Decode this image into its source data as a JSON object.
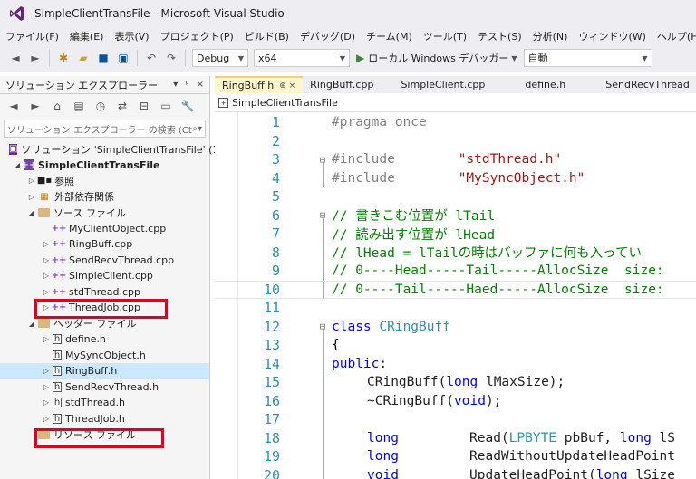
{
  "window": {
    "title": "SimpleClientTransFile - Microsoft Visual Studio"
  },
  "menu": [
    "ファイル(F)",
    "編集(E)",
    "表示(V)",
    "プロジェクト(P)",
    "ビルド(B)",
    "デバッグ(D)",
    "チーム(M)",
    "ツール(T)",
    "テスト(S)",
    "分析(N)",
    "ウィンドウ(W)",
    "ヘルプ(H)"
  ],
  "toolbar": {
    "config": "Debug",
    "platform": "x64",
    "run_label": "ローカル Windows デバッガー",
    "run_mode": "自動"
  },
  "solution_explorer": {
    "title": "ソリューション エクスプローラー",
    "search_placeholder": "ソリューション エクスプローラー の検索 (Ct",
    "items": [
      {
        "label": "ソリューション 'SimpleClientTransFile' (1",
        "icon": "solution-icon"
      },
      {
        "label": "SimpleClientTransFile",
        "icon": "project-icon"
      },
      {
        "label": "参照",
        "icon": "references-icon"
      },
      {
        "label": "外部依存関係",
        "icon": "external-deps-icon"
      },
      {
        "label": "ソース ファイル",
        "icon": "folder-icon"
      },
      {
        "label": "MyClientObject.cpp",
        "icon": "cpp-file-icon"
      },
      {
        "label": "RingBuff.cpp",
        "icon": "cpp-file-icon"
      },
      {
        "label": "SendRecvThread.cpp",
        "icon": "cpp-file-icon"
      },
      {
        "label": "SimpleClient.cpp",
        "icon": "cpp-file-icon"
      },
      {
        "label": "stdThread.cpp",
        "icon": "cpp-file-icon"
      },
      {
        "label": "ThreadJob.cpp",
        "icon": "cpp-file-icon"
      },
      {
        "label": "ヘッダー ファイル",
        "icon": "folder-icon"
      },
      {
        "label": "define.h",
        "icon": "h-file-icon"
      },
      {
        "label": "MySyncObject.h",
        "icon": "h-file-icon"
      },
      {
        "label": "RingBuff.h",
        "icon": "h-file-icon"
      },
      {
        "label": "SendRecvThread.h",
        "icon": "h-file-icon"
      },
      {
        "label": "stdThread.h",
        "icon": "h-file-icon"
      },
      {
        "label": "ThreadJob.h",
        "icon": "h-file-icon"
      },
      {
        "label": "リソース ファイル",
        "icon": "folder-icon"
      }
    ]
  },
  "tabs": [
    {
      "label": "RingBuff.h",
      "pin": "⊕ ×"
    },
    {
      "label": "RingBuff.cpp"
    },
    {
      "label": "SimpleClient.cpp"
    },
    {
      "label": "define.h"
    },
    {
      "label": "SendRecvThread"
    }
  ],
  "navbar": {
    "project": "SimpleClientTransFile"
  },
  "code": {
    "line_numbers": [
      "1",
      "2",
      "3",
      "4",
      "5",
      "6",
      "7",
      "8",
      "9",
      "10",
      "11",
      "12",
      "13",
      "14",
      "15",
      "16",
      "17",
      "18",
      "19",
      "20"
    ],
    "l1": {
      "a": "#pragma once"
    },
    "l3": {
      "a": "#include",
      "b": "\"stdThread.h\""
    },
    "l4": {
      "a": "#include",
      "b": "\"MySyncObject.h\""
    },
    "l6": {
      "a": "// 書きこむ位置が lTail"
    },
    "l7": {
      "a": "// 読み出す位置が lHead"
    },
    "l8": {
      "a": "// lHead = lTailの時はバッファに何も入ってい"
    },
    "l9": {
      "a": "// 0----Head-----Tail-----AllocSize  size:"
    },
    "l10": {
      "a": "// 0----Tail-----Haed-----AllocSize  size:"
    },
    "l12": {
      "a": "class",
      "b": "CRingBuff"
    },
    "l13": {
      "a": "{"
    },
    "l14": {
      "a": "public",
      "b": ":"
    },
    "l15": {
      "a": "CRingBuff(",
      "b": "long",
      "c": " lMaxSize);"
    },
    "l16": {
      "a": "~CRingBuff(",
      "b": "void",
      "c": ");"
    },
    "l18": {
      "a": "long",
      "b": "Read(",
      "c": "LPBYTE",
      "d": " pbBuf, ",
      "e": "long",
      "f": " lS"
    },
    "l19": {
      "a": "long",
      "b": "ReadWithoutUpdateHeadPoint"
    },
    "l20": {
      "a": "void",
      "b": "UpdateHeadPoint(",
      "c": "long",
      "d": " lSize"
    }
  },
  "colors": {
    "keyword": "#0000ff",
    "comment": "#008000",
    "string": "#a31515",
    "type": "#2b91af",
    "highlight": "#e2001a"
  }
}
